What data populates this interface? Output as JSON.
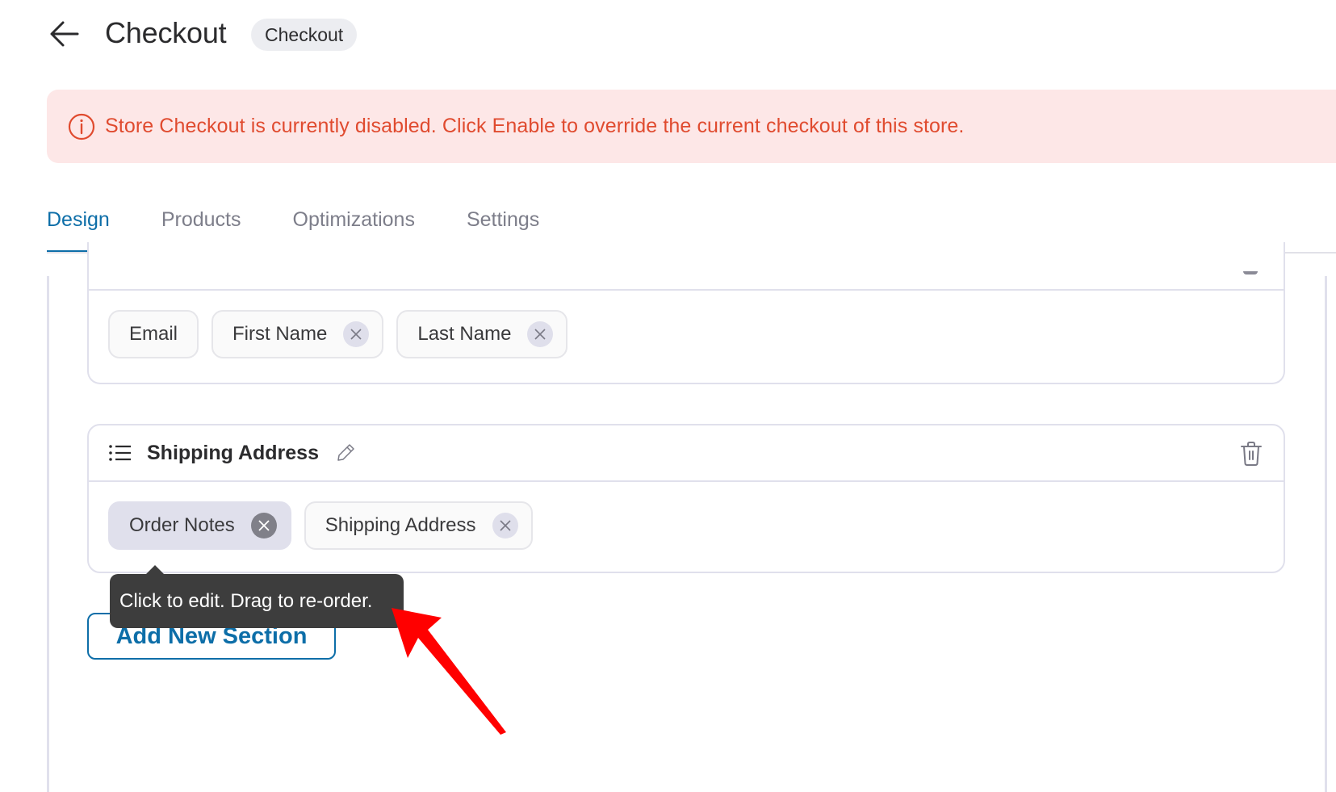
{
  "header": {
    "title": "Checkout",
    "type_badge": "Checkout"
  },
  "alert": {
    "icon": "info-circle-icon",
    "message": "Store Checkout is currently disabled. Click Enable to override the current checkout of this store.",
    "color": "#e04b2f",
    "background": "#fde7e7"
  },
  "tabs": [
    {
      "label": "Design",
      "active": true
    },
    {
      "label": "Products",
      "active": false
    },
    {
      "label": "Optimizations",
      "active": false
    },
    {
      "label": "Settings",
      "active": false
    }
  ],
  "sections": [
    {
      "title": "",
      "fields": [
        {
          "label": "Email",
          "removable": false
        },
        {
          "label": "First Name",
          "removable": true
        },
        {
          "label": "Last Name",
          "removable": true
        }
      ]
    },
    {
      "title": "Shipping Address",
      "fields": [
        {
          "label": "Order Notes",
          "removable": true,
          "hovered": true
        },
        {
          "label": "Shipping Address",
          "removable": true
        }
      ]
    }
  ],
  "tooltip": {
    "text": "Click to edit. Drag to re-order."
  },
  "add_section_button": {
    "label": "Add New Section"
  },
  "colors": {
    "accent": "#0d6ea8",
    "annotation_arrow": "#ff0000"
  }
}
